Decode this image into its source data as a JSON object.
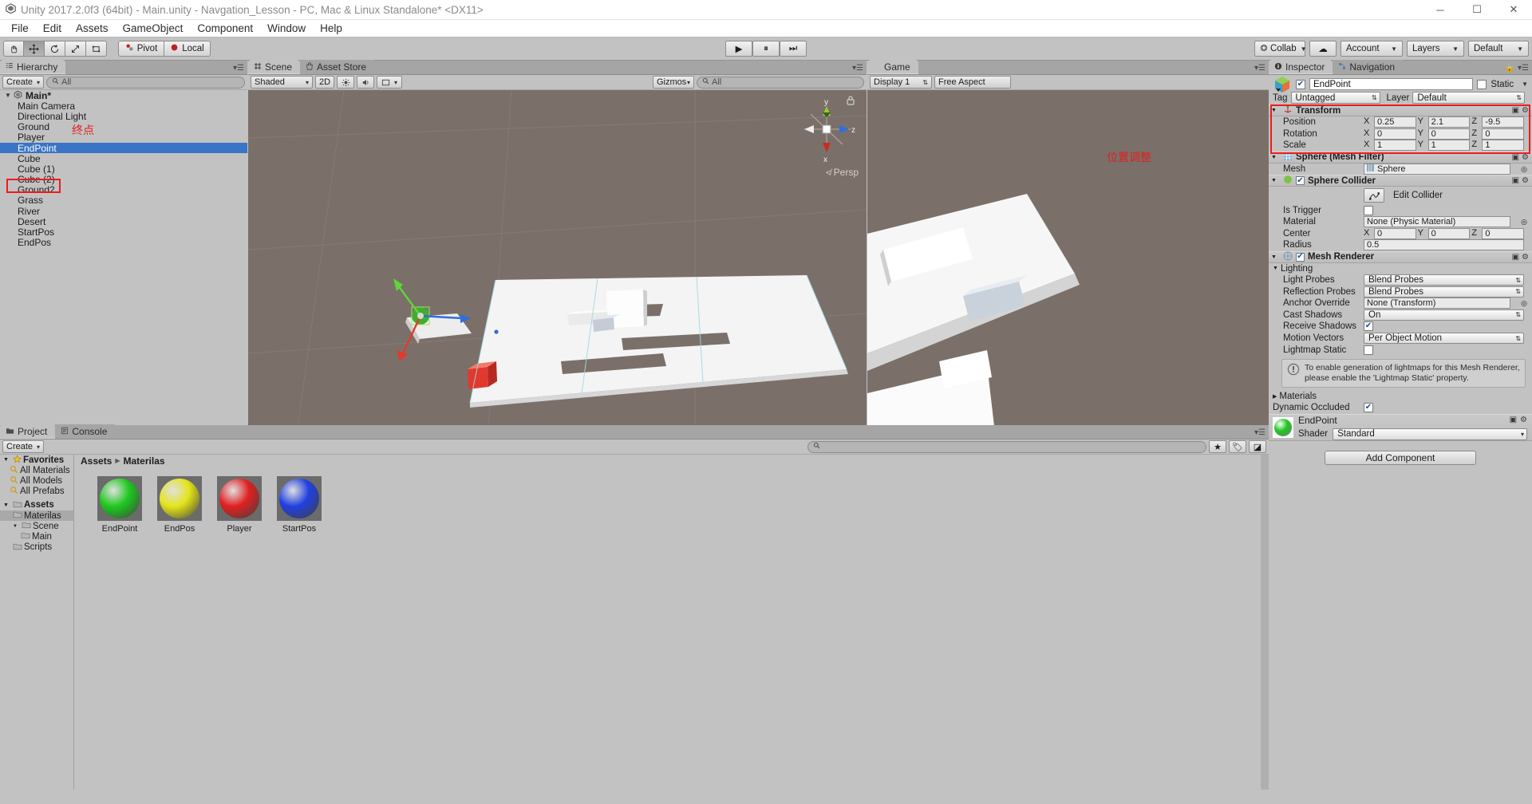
{
  "window": {
    "title": "Unity 2017.2.0f3 (64bit) - Main.unity - Navgation_Lesson - PC, Mac & Linux Standalone* <DX11>",
    "app_icon": "unity-logo-icon",
    "minimize": "─",
    "maximize": "☐",
    "close": "✕"
  },
  "menu": {
    "items": [
      "File",
      "Edit",
      "Assets",
      "GameObject",
      "Component",
      "Window",
      "Help"
    ]
  },
  "toolbar": {
    "tools": [
      {
        "name": "hand-tool",
        "glyph": "✋",
        "active": false
      },
      {
        "name": "move-tool",
        "glyph": "✥",
        "active": true
      },
      {
        "name": "rotate-tool",
        "glyph": "↻",
        "active": false
      },
      {
        "name": "scale-tool",
        "glyph": "⤡",
        "active": false
      },
      {
        "name": "rect-tool",
        "glyph": "⧉",
        "active": false
      }
    ],
    "pivot_label": "Pivot",
    "local_label": "Local",
    "play": "▶",
    "pause": "⏸",
    "step": "⏭",
    "collab_label": "Collab",
    "cloud_label": "☁",
    "account_label": "Account",
    "layers_label": "Layers",
    "layout_label": "Default"
  },
  "hierarchy": {
    "tab_label": "Hierarchy",
    "tab_icon": "hierarchy-icon",
    "create_label": "Create",
    "search_placeholder": "All",
    "root": "Main*",
    "items": [
      {
        "label": "Main Camera",
        "selected": false
      },
      {
        "label": "Directional Light",
        "selected": false
      },
      {
        "label": "Ground",
        "selected": false
      },
      {
        "label": "Player",
        "selected": false
      },
      {
        "label": "EndPoint",
        "selected": true
      },
      {
        "label": "Cube",
        "selected": false
      },
      {
        "label": "Cube (1)",
        "selected": false
      },
      {
        "label": "Cube (2)",
        "selected": false
      },
      {
        "label": "Ground2",
        "selected": false
      },
      {
        "label": "Grass",
        "selected": false
      },
      {
        "label": "River",
        "selected": false
      },
      {
        "label": "Desert",
        "selected": false
      },
      {
        "label": "StartPos",
        "selected": false
      },
      {
        "label": "EndPos",
        "selected": false
      }
    ],
    "annotation": "终点"
  },
  "scene": {
    "tab_label": "Scene",
    "tab_icon": "scene-grid-icon",
    "asset_store_label": "Asset Store",
    "asset_store_icon": "asset-store-bag-icon",
    "draw_mode": "Shaded",
    "two_d_label": "2D",
    "lighting_icon": "sun-icon",
    "audio_icon": "speaker-icon",
    "fx_icon": "effects-icon",
    "gizmos_label": "Gizmos",
    "search_placeholder": "All",
    "axis_labels": {
      "y": "y",
      "z": "z",
      "x": "x"
    },
    "persp_label": "Persp"
  },
  "game": {
    "tab_label": "Game",
    "tab_icon": "game-pad-icon",
    "display_label": "Display 1",
    "aspect_label": "Free Aspect",
    "annotation": "位置调整"
  },
  "project": {
    "tab_label": "Project",
    "tab_icon": "folder-icon",
    "console_tab_label": "Console",
    "console_icon": "console-icon",
    "create_label": "Create",
    "search_placeholder": "",
    "favorites_label": "Favorites",
    "favorites": [
      "All Materials",
      "All Models",
      "All Prefabs"
    ],
    "assets_label": "Assets",
    "tree": [
      {
        "label": "Materilas",
        "selected": true,
        "depth": 1
      },
      {
        "label": "Scene",
        "selected": false,
        "depth": 1
      },
      {
        "label": "Main",
        "selected": false,
        "depth": 2
      },
      {
        "label": "Scripts",
        "selected": false,
        "depth": 1
      }
    ],
    "breadcrumb": [
      "Assets",
      "Materilas"
    ],
    "assets": [
      {
        "label": "EndPoint",
        "color": "#1ec81e"
      },
      {
        "label": "EndPos",
        "color": "#e4e41a"
      },
      {
        "label": "Player",
        "color": "#e02020"
      },
      {
        "label": "StartPos",
        "color": "#2040e0"
      }
    ]
  },
  "inspector": {
    "tab_label": "Inspector",
    "tab_icon": "info-circle-icon",
    "navigation_tab_label": "Navigation",
    "navigation_tab_icon": "navmesh-icon",
    "lock_icon": "lock-icon",
    "object_icon": "cube-prefab-icon",
    "object_enabled": true,
    "object_name": "EndPoint",
    "static_label": "Static",
    "static_checked": false,
    "tag_label": "Tag",
    "tag_value": "Untagged",
    "layer_label": "Layer",
    "layer_value": "Default",
    "transform": {
      "title": "Transform",
      "icon": "transform-axis-icon",
      "rows": [
        {
          "label": "Position",
          "x": "0.25",
          "y": "2.1",
          "z": "-9.5"
        },
        {
          "label": "Rotation",
          "x": "0",
          "y": "0",
          "z": "0"
        },
        {
          "label": "Scale",
          "x": "1",
          "y": "1",
          "z": "1"
        }
      ],
      "annotation": "位置调整"
    },
    "mesh_filter": {
      "title": "Sphere (Mesh Filter)",
      "icon": "mesh-filter-icon",
      "mesh_label": "Mesh",
      "mesh_value": "Sphere"
    },
    "sphere_collider": {
      "title": "Sphere Collider",
      "icon": "collider-icon",
      "enabled": true,
      "edit_collider_label": "Edit Collider",
      "edit_collider_icon": "edit-collider-icon",
      "is_trigger_label": "Is Trigger",
      "is_trigger_checked": false,
      "material_label": "Material",
      "material_value": "None (Physic Material)",
      "center_label": "Center",
      "center": {
        "x": "0",
        "y": "0",
        "z": "0"
      },
      "radius_label": "Radius",
      "radius_value": "0.5"
    },
    "mesh_renderer": {
      "title": "Mesh Renderer",
      "icon": "mesh-renderer-icon",
      "enabled": true,
      "lighting_label": "Lighting",
      "rows": [
        {
          "label": "Light Probes",
          "value": "Blend Probes",
          "type": "dropdown"
        },
        {
          "label": "Reflection Probes",
          "value": "Blend Probes",
          "type": "dropdown"
        },
        {
          "label": "Anchor Override",
          "value": "None (Transform)",
          "type": "object"
        },
        {
          "label": "Cast Shadows",
          "value": "On",
          "type": "dropdown"
        },
        {
          "label": "Receive Shadows",
          "value": "",
          "type": "checkbox",
          "checked": true
        },
        {
          "label": "Motion Vectors",
          "value": "Per Object Motion",
          "type": "dropdown"
        },
        {
          "label": "Lightmap Static",
          "value": "",
          "type": "checkbox",
          "checked": false
        }
      ],
      "helpbox": "To enable generation of lightmaps for this Mesh Renderer, please enable the 'Lightmap Static' property.",
      "help_icon": "warning-icon",
      "materials_label": "Materials",
      "dynamic_occluded_label": "Dynamic Occluded",
      "dynamic_occluded_checked": true
    },
    "material": {
      "name": "EndPoint",
      "preview_color": "#1ec81e",
      "shader_label": "Shader",
      "shader_value": "Standard"
    },
    "add_component_label": "Add Component"
  },
  "colors": {
    "selection_blue": "#3a74c4",
    "annotation_red": "#e02020",
    "panel_gray": "#c2c2c2",
    "viewport_brown": "#7a7069"
  }
}
